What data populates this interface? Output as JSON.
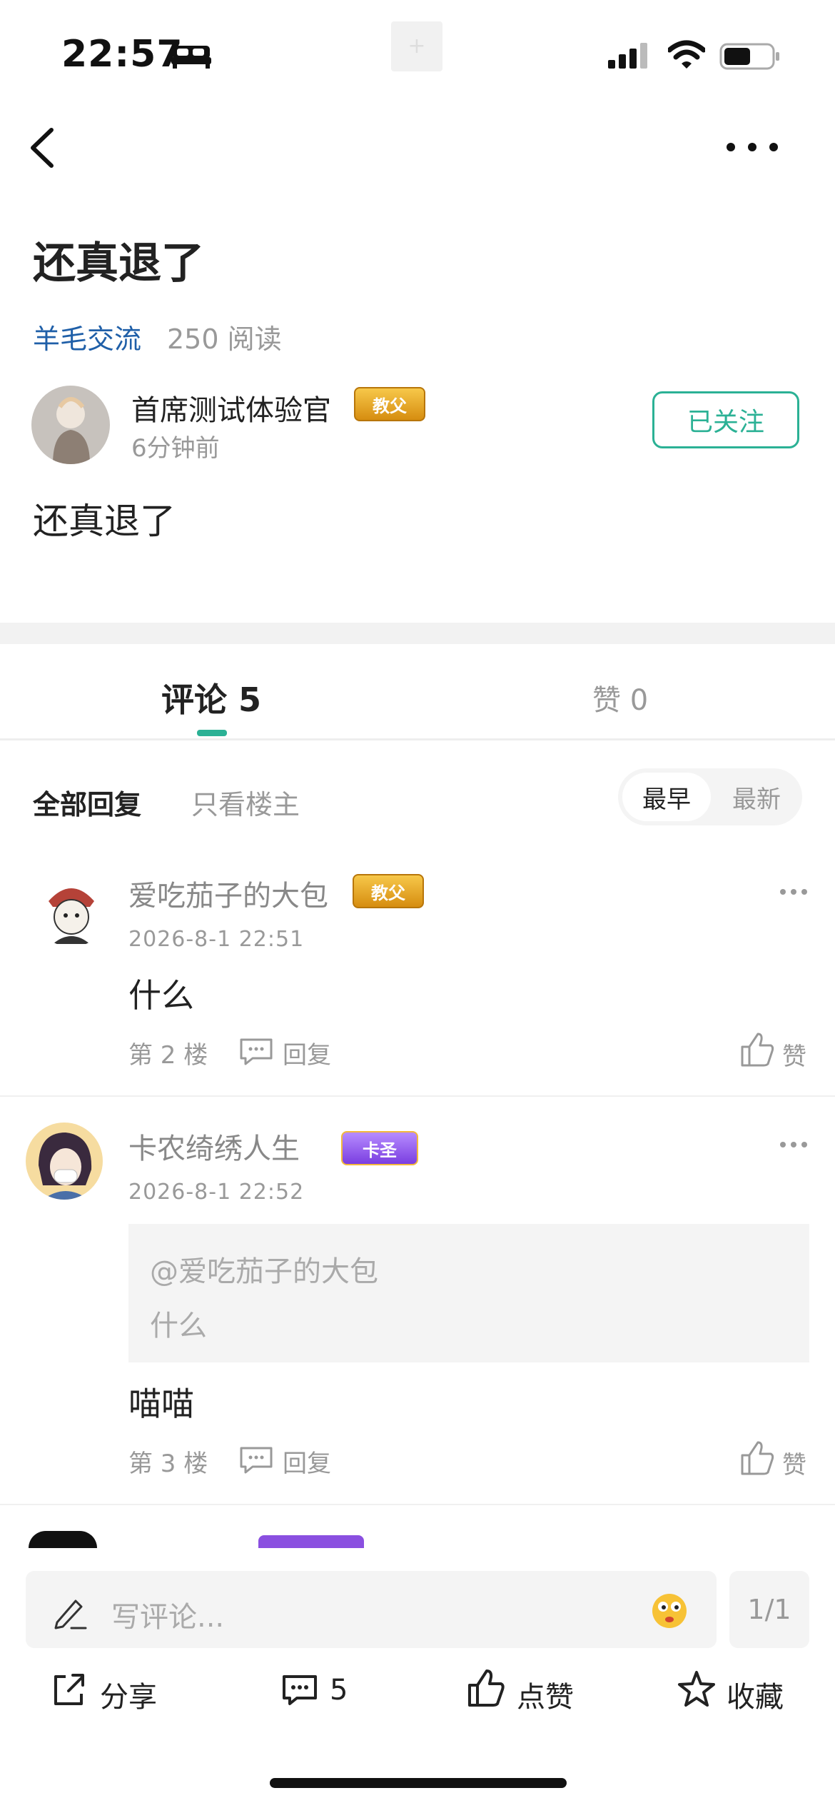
{
  "status_bar": {
    "time": "22:57",
    "add_glyph": "+"
  },
  "post": {
    "title": "还真退了",
    "topic": "羊毛交流",
    "read_count": "250 阅读",
    "author": {
      "name": "首席测试体验官",
      "badge": "教父",
      "time": "6分钟前"
    },
    "follow_label": "已关注",
    "body": "还真退了"
  },
  "tabs": {
    "comments": "评论 5",
    "likes": "赞 0"
  },
  "filters": {
    "all": "全部回复",
    "host_only": "只看楼主",
    "sort_earliest": "最早",
    "sort_latest": "最新"
  },
  "comments": [
    {
      "user": "爱吃茄子的大包",
      "badge": "教父",
      "date": "2026-8-1 22:51",
      "text": "什么",
      "floor": "第 2 楼",
      "reply_label": "回复",
      "like_label": "赞"
    },
    {
      "user": "卡农绮绣人生",
      "badge": "卡圣",
      "date": "2026-8-1 22:52",
      "quote_user": "@爱吃茄子的大包",
      "quote_text": "什么",
      "text": "喵喵",
      "floor": "第 3 楼",
      "reply_label": "回复",
      "like_label": "赞"
    }
  ],
  "bottom": {
    "input_placeholder": "写评论...",
    "page": "1/1",
    "share_label": "分享",
    "comment_count": "5",
    "like_label": "点赞",
    "favorite_label": "收藏"
  },
  "colors": {
    "accent": "#2bb195",
    "link": "#1f5fa8"
  },
  "icons": [
    "bed-icon",
    "signal-icon",
    "wifi-icon",
    "battery-icon",
    "back-icon",
    "more-icon",
    "comment-bubble-icon",
    "thumb-up-icon",
    "edit-icon",
    "emoji-icon",
    "share-icon",
    "star-icon"
  ]
}
